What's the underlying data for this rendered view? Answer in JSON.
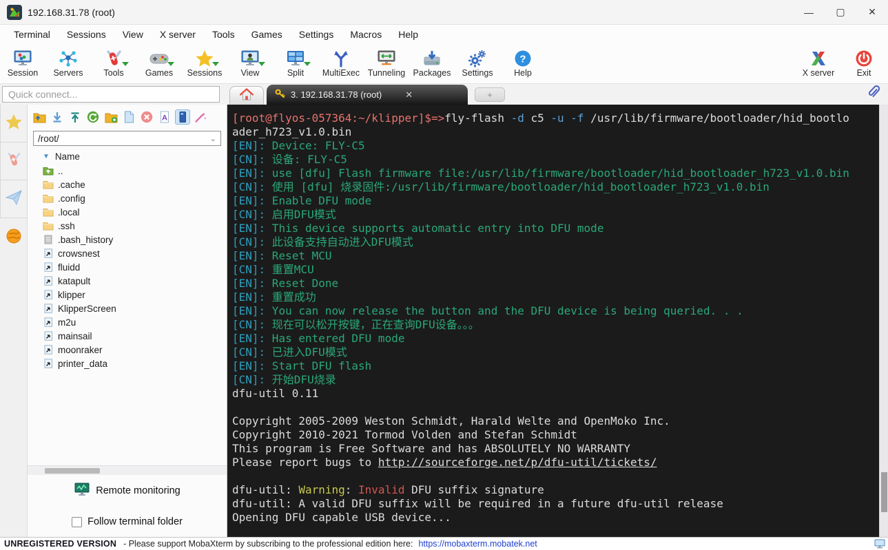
{
  "window": {
    "title": "192.168.31.78 (root)"
  },
  "menu": {
    "items": [
      "Terminal",
      "Sessions",
      "View",
      "X server",
      "Tools",
      "Games",
      "Settings",
      "Macros",
      "Help"
    ]
  },
  "toolbar": {
    "items": [
      {
        "label": "Session",
        "icon": "session-icon",
        "menu": false
      },
      {
        "label": "Servers",
        "icon": "servers-icon",
        "menu": false
      },
      {
        "label": "Tools",
        "icon": "tools-knife-icon",
        "menu": true
      },
      {
        "label": "Games",
        "icon": "games-icon",
        "menu": true
      },
      {
        "label": "Sessions",
        "icon": "sessions-star-icon",
        "menu": true
      },
      {
        "label": "View",
        "icon": "view-icon",
        "menu": true
      },
      {
        "label": "Split",
        "icon": "split-icon",
        "menu": true
      },
      {
        "label": "MultiExec",
        "icon": "multiexec-icon",
        "menu": false
      },
      {
        "label": "Tunneling",
        "icon": "tunneling-icon",
        "menu": false
      },
      {
        "label": "Packages",
        "icon": "packages-icon",
        "menu": false
      },
      {
        "label": "Settings",
        "icon": "settings-gear-icon",
        "menu": false
      },
      {
        "label": "Help",
        "icon": "help-icon",
        "menu": false
      }
    ],
    "right_items": [
      {
        "label": "X server",
        "icon": "xserver-icon",
        "menu": false
      },
      {
        "label": "Exit",
        "icon": "exit-power-icon",
        "menu": false
      }
    ]
  },
  "tabs": {
    "quick_connect_placeholder": "Quick connect...",
    "active_tab_label": "3. 192.168.31.78 (root)",
    "close_glyph": "✕",
    "plus_glyph": "+"
  },
  "left_strip": {
    "items": [
      {
        "icon": "star-icon",
        "name": "sidebar-sessions"
      },
      {
        "icon": "knife-icon",
        "name": "sidebar-tools"
      },
      {
        "icon": "paper-plane-icon",
        "name": "sidebar-macros"
      },
      {
        "icon": "globe-icon",
        "name": "sftp-session-indicator"
      }
    ]
  },
  "file_panel": {
    "toolbar": [
      {
        "icon": "parent-folder-icon",
        "selected": false
      },
      {
        "icon": "download-icon",
        "selected": false
      },
      {
        "icon": "upload-icon",
        "selected": false
      },
      {
        "icon": "refresh-icon",
        "selected": false
      },
      {
        "icon": "new-folder-icon",
        "selected": false
      },
      {
        "icon": "new-file-icon",
        "selected": false
      },
      {
        "icon": "delete-icon",
        "selected": false
      },
      {
        "icon": "rename-icon",
        "selected": false
      },
      {
        "icon": "sync-terminal-icon",
        "selected": true
      },
      {
        "icon": "tracking-wand-icon",
        "selected": false
      }
    ],
    "path": "/root/",
    "column_header": "Name",
    "files": [
      {
        "name": "..",
        "icon": "folder-up-icon"
      },
      {
        "name": ".cache",
        "icon": "folder-icon"
      },
      {
        "name": ".config",
        "icon": "folder-icon"
      },
      {
        "name": ".local",
        "icon": "folder-icon"
      },
      {
        "name": ".ssh",
        "icon": "folder-icon"
      },
      {
        "name": ".bash_history",
        "icon": "file-icon"
      },
      {
        "name": "crowsnest",
        "icon": "link-icon"
      },
      {
        "name": "fluidd",
        "icon": "link-icon"
      },
      {
        "name": "katapult",
        "icon": "link-icon"
      },
      {
        "name": "klipper",
        "icon": "link-icon"
      },
      {
        "name": "KlipperScreen",
        "icon": "link-icon"
      },
      {
        "name": "m2u",
        "icon": "link-icon"
      },
      {
        "name": "mainsail",
        "icon": "link-icon"
      },
      {
        "name": "moonraker",
        "icon": "link-icon"
      },
      {
        "name": "printer_data",
        "icon": "link-icon"
      }
    ],
    "remote_monitoring_label": "Remote monitoring",
    "follow_checkbox_label": "Follow terminal folder",
    "follow_checkbox_checked": false
  },
  "terminal": {
    "colors": {
      "background": "#1b1b1b",
      "prompt": "#e8736d",
      "plain": "#dcdcdc",
      "flag": "#5c9fd6",
      "tag": "#2e9fbe",
      "message": "#2aa879",
      "warning": "#c9c94e",
      "error": "#d4564e"
    },
    "lines": [
      [
        {
          "c": "prompt",
          "t": "[root@flyos-057364:~/klipper]$=>"
        },
        {
          "c": "plain",
          "t": "fly-flash "
        },
        {
          "c": "flag",
          "t": "-d"
        },
        {
          "c": "plain",
          "t": " c5 "
        },
        {
          "c": "flag",
          "t": "-u"
        },
        {
          "c": "plain",
          "t": " "
        },
        {
          "c": "flag",
          "t": "-f"
        },
        {
          "c": "plain",
          "t": " /usr/lib/firmware/bootloader/hid_bootlo"
        }
      ],
      [
        {
          "c": "plain",
          "t": "ader_h723_v1.0.bin"
        }
      ],
      [
        {
          "c": "tag",
          "t": "[EN]:"
        },
        {
          "c": "msg",
          "t": " Device: FLY-C5"
        }
      ],
      [
        {
          "c": "tag",
          "t": "[CN]:"
        },
        {
          "c": "msg",
          "t": " 设备: FLY-C5"
        }
      ],
      [
        {
          "c": "tag",
          "t": "[EN]:"
        },
        {
          "c": "msg",
          "t": " use [dfu] Flash firmware file:/usr/lib/firmware/bootloader/hid_bootloader_h723_v1.0.bin"
        }
      ],
      [
        {
          "c": "tag",
          "t": "[CN]:"
        },
        {
          "c": "msg",
          "t": " 使用 [dfu] 烧录固件:/usr/lib/firmware/bootloader/hid_bootloader_h723_v1.0.bin"
        }
      ],
      [
        {
          "c": "tag",
          "t": "[EN]:"
        },
        {
          "c": "msg",
          "t": " Enable DFU mode"
        }
      ],
      [
        {
          "c": "tag",
          "t": "[CN]:"
        },
        {
          "c": "msg",
          "t": " 启用DFU模式"
        }
      ],
      [
        {
          "c": "tag",
          "t": "[EN]:"
        },
        {
          "c": "msg",
          "t": " This device supports automatic entry into DFU mode"
        }
      ],
      [
        {
          "c": "tag",
          "t": "[CN]:"
        },
        {
          "c": "msg",
          "t": " 此设备支持自动进入DFU模式"
        }
      ],
      [
        {
          "c": "tag",
          "t": "[EN]:"
        },
        {
          "c": "msg",
          "t": " Reset MCU"
        }
      ],
      [
        {
          "c": "tag",
          "t": "[CN]:"
        },
        {
          "c": "msg",
          "t": " 重置MCU"
        }
      ],
      [
        {
          "c": "tag",
          "t": "[EN]:"
        },
        {
          "c": "msg",
          "t": " Reset Done"
        }
      ],
      [
        {
          "c": "tag",
          "t": "[EN]:"
        },
        {
          "c": "msg",
          "t": " 重置成功"
        }
      ],
      [
        {
          "c": "tag",
          "t": "[EN]:"
        },
        {
          "c": "msg",
          "t": " You can now release the button and the DFU device is being queried. . ."
        }
      ],
      [
        {
          "c": "tag",
          "t": "[CN]:"
        },
        {
          "c": "msg",
          "t": " 现在可以松开按键，正在查询DFU设备。。。"
        }
      ],
      [
        {
          "c": "tag",
          "t": "[EN]:"
        },
        {
          "c": "msg",
          "t": " Has entered DFU mode"
        }
      ],
      [
        {
          "c": "tag",
          "t": "[CN]:"
        },
        {
          "c": "msg",
          "t": " 已进入DFU模式"
        }
      ],
      [
        {
          "c": "tag",
          "t": "[EN]:"
        },
        {
          "c": "msg",
          "t": " Start DFU flash"
        }
      ],
      [
        {
          "c": "tag",
          "t": "[CN]:"
        },
        {
          "c": "msg",
          "t": " 开始DFU烧录"
        }
      ],
      [
        {
          "c": "plain",
          "t": "dfu-util 0.11"
        }
      ],
      [],
      [
        {
          "c": "plain",
          "t": "Copyright 2005-2009 Weston Schmidt, Harald Welte and OpenMoko Inc."
        }
      ],
      [
        {
          "c": "plain",
          "t": "Copyright 2010-2021 Tormod Volden and Stefan Schmidt"
        }
      ],
      [
        {
          "c": "plain",
          "t": "This program is Free Software and has ABSOLUTELY NO WARRANTY"
        }
      ],
      [
        {
          "c": "plain",
          "t": "Please report bugs to "
        },
        {
          "c": "link",
          "t": "http://sourceforge.net/p/dfu-util/tickets/"
        }
      ],
      [],
      [
        {
          "c": "plain",
          "t": "dfu-util: "
        },
        {
          "c": "warn",
          "t": "Warning"
        },
        {
          "c": "plain",
          "t": ": "
        },
        {
          "c": "err",
          "t": "Invalid"
        },
        {
          "c": "plain",
          "t": " DFU suffix signature"
        }
      ],
      [
        {
          "c": "plain",
          "t": "dfu-util: A valid DFU suffix will be required in a future dfu-util release"
        }
      ],
      [
        {
          "c": "plain",
          "t": "Opening DFU capable USB device..."
        }
      ]
    ]
  },
  "status_bar": {
    "registered": "UNREGISTERED VERSION",
    "message": "-  Please support MobaXterm by subscribing to the professional edition here:",
    "link": "https://mobaxterm.mobatek.net"
  }
}
